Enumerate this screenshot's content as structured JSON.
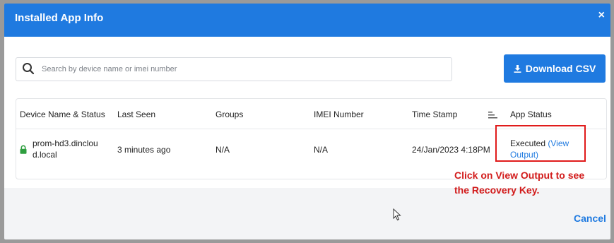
{
  "dialog": {
    "title": "Installed App Info",
    "close_label": "×"
  },
  "search": {
    "placeholder": "Search by device name or imei number"
  },
  "toolbar": {
    "download_label": "Download CSV"
  },
  "table": {
    "headers": [
      "Device Name & Status",
      "Last Seen",
      "Groups",
      "IMEI Number",
      "Time Stamp",
      "App Status"
    ],
    "rows": [
      {
        "device_line1": "prom-hd3.dinclou",
        "device_line2": "d.local",
        "last_seen": "3 minutes ago",
        "groups": "N/A",
        "imei": "N/A",
        "timestamp": "24/Jan/2023 4:18PM",
        "status": "Executed",
        "view_output_line1": "(View",
        "view_output_line2": "Output)"
      }
    ]
  },
  "annotation": {
    "line1": "Click on View Output to see",
    "line2": "the Recovery Key."
  },
  "footer": {
    "cancel_label": "Cancel"
  },
  "colors": {
    "accent": "#1f7ae0",
    "annotation_red": "#d21b1b",
    "online_green": "#2e9e3f"
  }
}
